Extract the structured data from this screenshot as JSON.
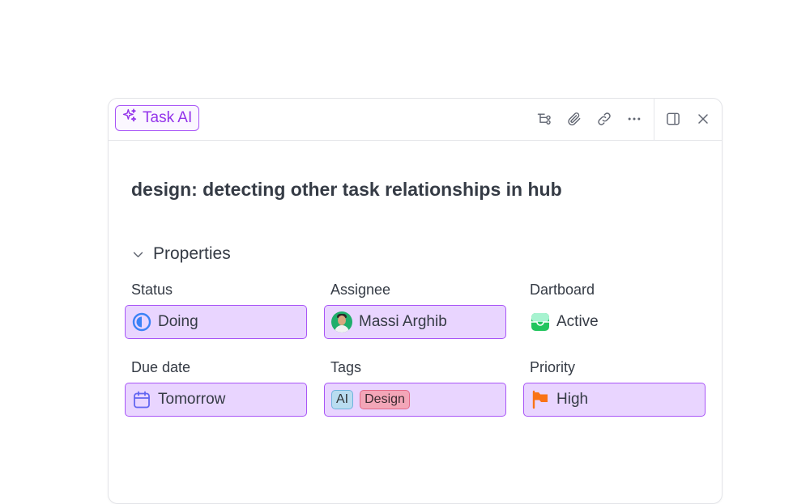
{
  "header": {
    "task_ai_label": "Task AI",
    "toolbar_icons": [
      "relationships-icon",
      "attachment-icon",
      "link-icon",
      "more-icon"
    ],
    "right_icons": [
      "sidebar-toggle-icon",
      "close-icon"
    ]
  },
  "task": {
    "title": "design: detecting other task relationships in hub"
  },
  "properties": {
    "heading": "Properties",
    "status": {
      "label": "Status",
      "value": "Doing",
      "icon": "status-doing-icon",
      "color": "#3b82f6"
    },
    "assignee": {
      "label": "Assignee",
      "value": "Massi Arghib",
      "icon": "avatar"
    },
    "dartboard": {
      "label": "Dartboard",
      "value": "Active",
      "icon": "dartboard-icon",
      "color": "#22c55e"
    },
    "due_date": {
      "label": "Due date",
      "value": "Tomorrow",
      "icon": "calendar-icon",
      "color": "#6366f1"
    },
    "tags": {
      "label": "Tags",
      "values": [
        "AI",
        "Design"
      ]
    },
    "priority": {
      "label": "Priority",
      "value": "High",
      "icon": "flag-icon",
      "color": "#f97316"
    }
  },
  "colors": {
    "accent": "#a855f7",
    "highlight_fill": "#e9d5ff",
    "text": "#353b45"
  }
}
